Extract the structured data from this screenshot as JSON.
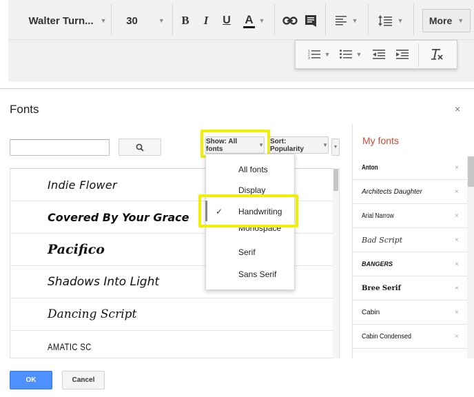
{
  "toolbar": {
    "font_name": "Walter Turn...",
    "font_size": "30",
    "bold": "B",
    "italic": "I",
    "underline": "U",
    "text_color": "A",
    "more_label": "More"
  },
  "dialog": {
    "title": "Fonts",
    "close": "×",
    "search": {
      "value": "",
      "placeholder": ""
    },
    "show_button": "Show: All fonts",
    "sort_button": "Sort: Popularity",
    "fonts": [
      "Indie Flower",
      "Covered By Your Grace",
      "Pacifico",
      "Shadows Into Light",
      "Dancing Script",
      "AMATIC SC"
    ],
    "show_menu": {
      "items": [
        "All fonts",
        "Display",
        "Handwriting",
        "Monospace",
        "Serif",
        "Sans Serif"
      ],
      "selected": "Handwriting",
      "check_mark": "✓"
    },
    "my_fonts": {
      "title": "My fonts",
      "remove_label": "×",
      "items": [
        "Anton",
        "Architects Daughter",
        "Arial Narrow",
        "Bad Script",
        "BANGERS",
        "Bree Serif",
        "Cabin",
        "Cabin Condensed"
      ]
    },
    "ok_label": "OK",
    "cancel_label": "Cancel"
  },
  "colors": {
    "accent_blue": "#4d90fe",
    "my_fonts_title": "#d14836",
    "highlight": "#f0f000"
  }
}
